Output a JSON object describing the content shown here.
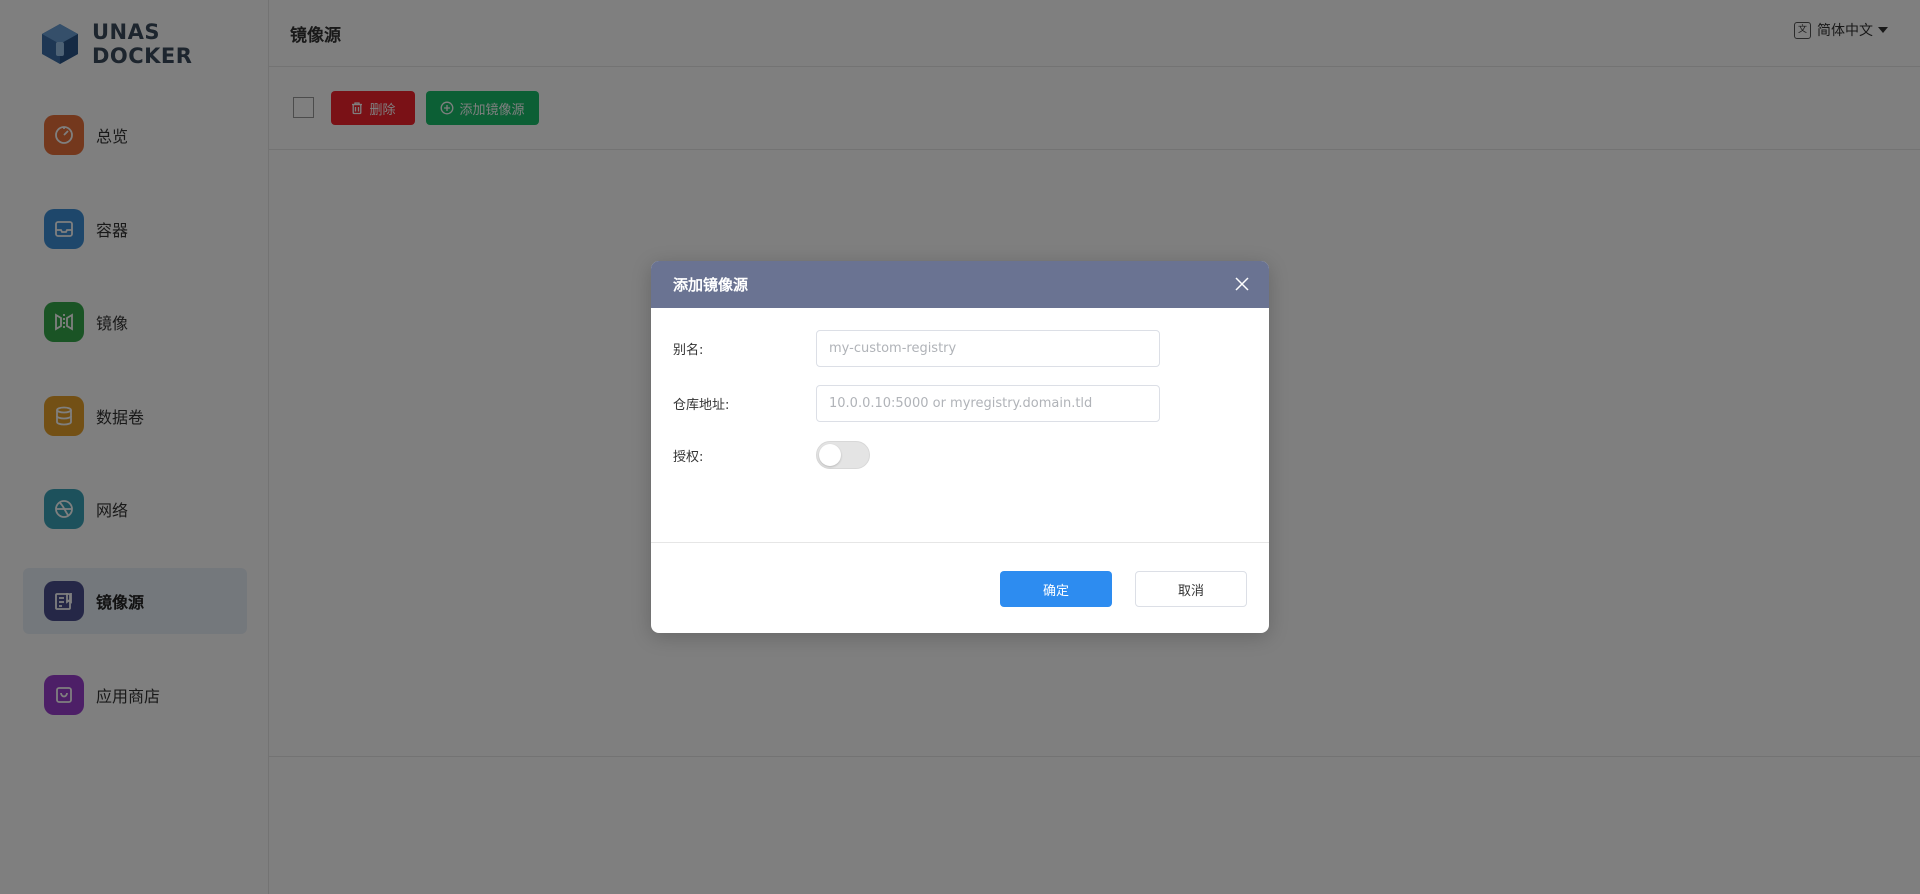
{
  "app": {
    "logo_text": "UNAS DOCKER",
    "logo_icon": "hexagon-cube-icon"
  },
  "sidebar": {
    "items": [
      {
        "label": "总览",
        "icon": "dashboard-icon",
        "color": "#e8703a"
      },
      {
        "label": "容器",
        "icon": "inbox-icon",
        "color": "#3d8fd6"
      },
      {
        "label": "镜像",
        "icon": "mirror-icon",
        "color": "#35a84a"
      },
      {
        "label": "数据卷",
        "icon": "database-icon",
        "color": "#e6a02a"
      },
      {
        "label": "网络",
        "icon": "globe-icon",
        "color": "#3aa3b8"
      },
      {
        "label": "镜像源",
        "icon": "registry-icon",
        "color": "#4a4f8f",
        "active": true
      },
      {
        "label": "应用商店",
        "icon": "store-icon",
        "color": "#9b3fcf"
      }
    ]
  },
  "header": {
    "title": "镜像源",
    "language": "简体中文",
    "language_icon": "translate-icon"
  },
  "toolbar": {
    "delete_label": "删除",
    "add_label": "添加镜像源"
  },
  "modal": {
    "title": "添加镜像源",
    "fields": {
      "alias_label": "别名:",
      "alias_placeholder": "my-custom-registry",
      "url_label": "仓库地址:",
      "url_placeholder": "10.0.0.10:5000 or myregistry.domain.tld",
      "auth_label": "授权:"
    },
    "ok_label": "确定",
    "cancel_label": "取消"
  },
  "colors": {
    "danger": "#f5222d",
    "success": "#19be6b",
    "primary": "#2d8cf0",
    "modal_header": "#6a7392"
  }
}
